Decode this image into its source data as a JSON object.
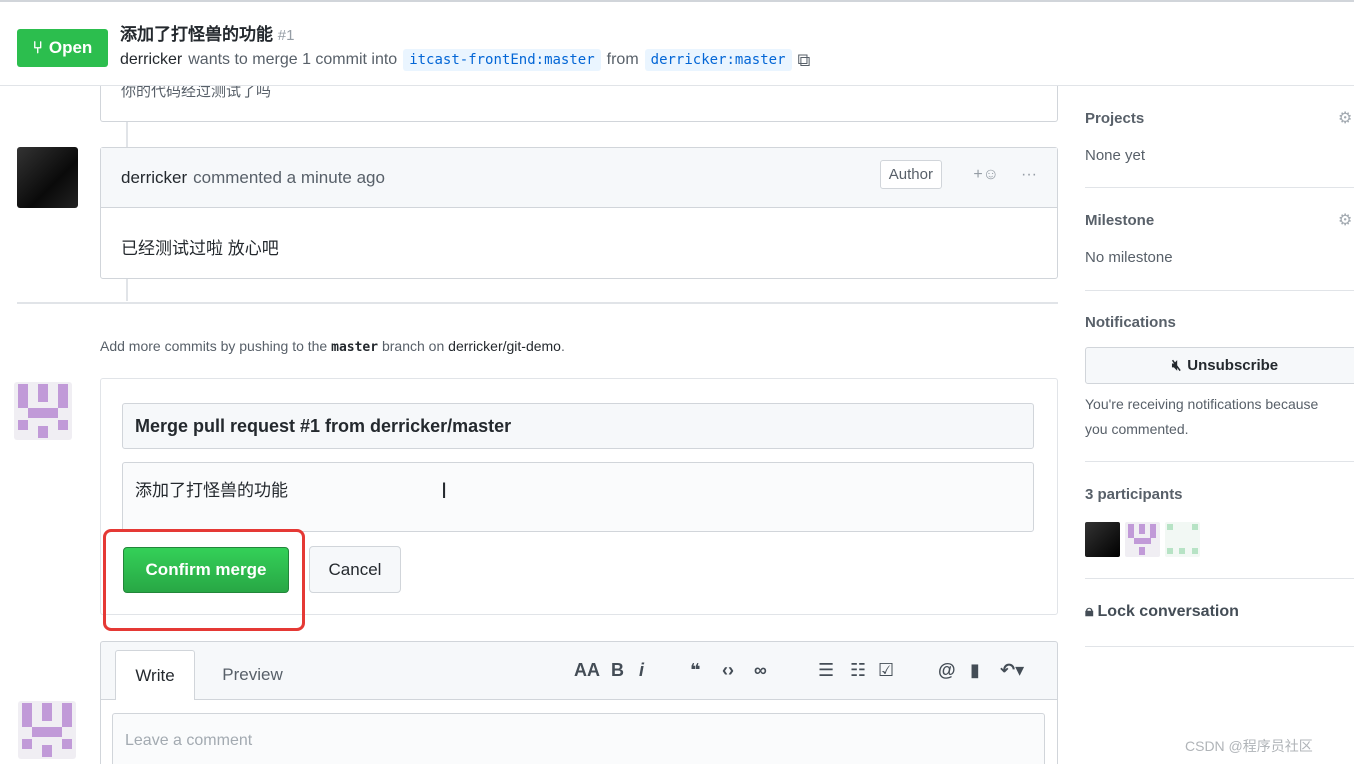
{
  "header": {
    "state": "Open",
    "title": "添加了打怪兽的功能",
    "number": "#1",
    "author": "derricker",
    "meta_mid": "wants to merge 1 commit into",
    "base_branch": "itcast-frontEnd:master",
    "from_word": "from",
    "head_branch": "derricker:master"
  },
  "timeline": {
    "prev_comment_fragment": "你的代码经过测试了吗",
    "comment": {
      "author": "derricker",
      "time": "commented a minute ago",
      "badge": "Author",
      "body": "已经测试过啦 放心吧"
    },
    "hint": {
      "prefix": "Add more commits by pushing to the",
      "branch": "master",
      "middle": "branch on",
      "repo": "derricker/git-demo",
      "suffix": "."
    }
  },
  "merge": {
    "title_value": "Merge pull request #1 from derricker/master",
    "body_value": "添加了打怪兽的功能",
    "confirm_label": "Confirm merge",
    "cancel_label": "Cancel"
  },
  "composer": {
    "tab_write": "Write",
    "tab_preview": "Preview",
    "placeholder": "Leave a comment"
  },
  "sidebar": {
    "projects_label": "Projects",
    "projects_value": "None yet",
    "milestone_label": "Milestone",
    "milestone_value": "No milestone",
    "notifications_label": "Notifications",
    "unsubscribe_label": "Unsubscribe",
    "notif_reason_1": "You're receiving notifications because",
    "notif_reason_2": "you commented.",
    "participants_label": "3 participants",
    "lock_label": "Lock conversation"
  },
  "watermark": "CSDN @程序员社区",
  "colors": {
    "open_green": "#2cbe4e",
    "confirm_green": "#28a745",
    "highlight_red": "#e53935",
    "branch_blue": "#0366d6"
  }
}
